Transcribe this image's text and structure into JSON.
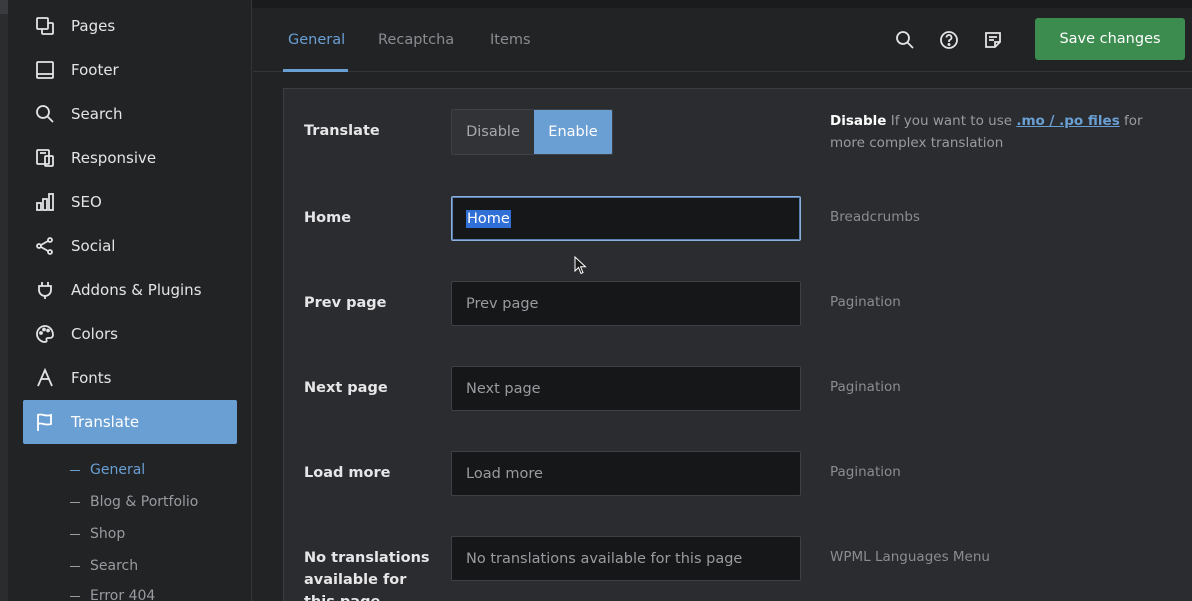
{
  "sidebar": {
    "items": [
      {
        "label": "Pages",
        "icon": "pages-icon"
      },
      {
        "label": "Footer",
        "icon": "footer-icon"
      },
      {
        "label": "Search",
        "icon": "search-icon"
      },
      {
        "label": "Responsive",
        "icon": "responsive-icon"
      },
      {
        "label": "SEO",
        "icon": "seo-chart-icon"
      },
      {
        "label": "Social",
        "icon": "share-icon"
      },
      {
        "label": "Addons & Plugins",
        "icon": "plug-icon"
      },
      {
        "label": "Colors",
        "icon": "palette-icon"
      },
      {
        "label": "Fonts",
        "icon": "font-icon"
      },
      {
        "label": "Translate",
        "icon": "flag-icon",
        "active": true
      }
    ],
    "subitems": [
      {
        "label": "General",
        "active": true
      },
      {
        "label": "Blog & Portfolio"
      },
      {
        "label": "Shop"
      },
      {
        "label": "Search"
      },
      {
        "label": "Error 404"
      }
    ]
  },
  "topbar": {
    "tabs": [
      "General",
      "Recaptcha",
      "Items"
    ],
    "active_tab": "General",
    "save_label": "Save changes",
    "accent_color": "#6a9fd4",
    "save_color": "#3c8b4f"
  },
  "form": {
    "translate": {
      "label": "Translate",
      "options": [
        "Disable",
        "Enable"
      ],
      "selected": "Enable",
      "note_bold": "Disable",
      "note_text_1": " If you want to use ",
      "note_link": ".mo / .po files",
      "note_text_2": " for more complex translation"
    },
    "home": {
      "label": "Home",
      "value": "Home",
      "hint": "Breadcrumbs"
    },
    "prev_page": {
      "label": "Prev page",
      "value": "Prev page",
      "hint": "Pagination"
    },
    "next_page": {
      "label": "Next page",
      "value": "Next page",
      "hint": "Pagination"
    },
    "load_more": {
      "label": "Load more",
      "value": "Load more",
      "hint": "Pagination"
    },
    "no_translations": {
      "label": "No translations available for this page",
      "value": "No translations available for this page",
      "hint": "WPML Languages Menu"
    }
  }
}
